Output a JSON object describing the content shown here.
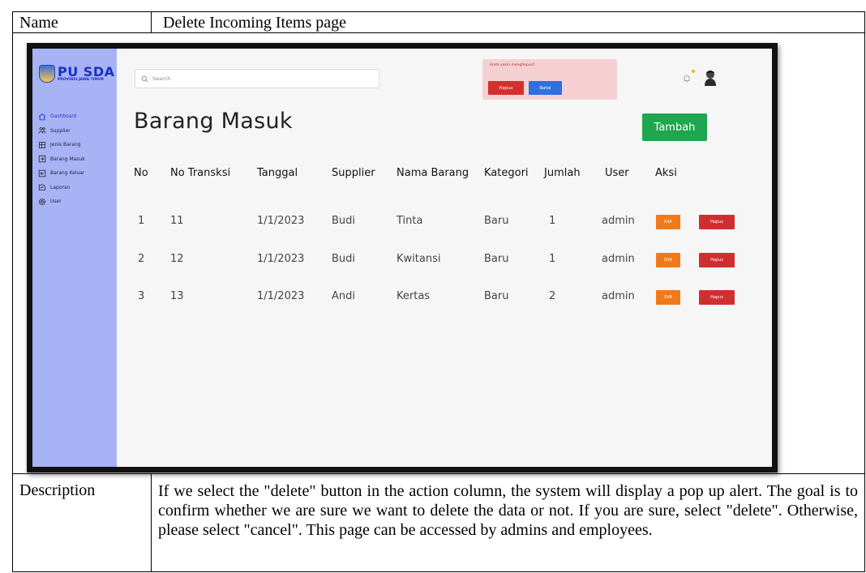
{
  "document": {
    "name_label": "Name",
    "name_value": "Delete Incoming Items page",
    "description_label": "Description",
    "description_text": "If we select the \"delete\" button in the action column, the system will display a pop up alert. The goal is to confirm whether we are sure we want to delete the data or not. If you are sure, select \"delete\". Otherwise, please select \"cancel\". This page can be accessed by admins and employees."
  },
  "app": {
    "logo": {
      "main": "PU SDA",
      "sub": "PROVINSI JAWA TIMUR"
    },
    "search_placeholder": "Search",
    "page_title": "Barang Masuk",
    "add_button": "Tambah",
    "sidebar": [
      {
        "label": "Dashboard",
        "icon": "home-icon",
        "active": true
      },
      {
        "label": "Supplier",
        "icon": "users-icon",
        "active": false
      },
      {
        "label": "Jenis Barang",
        "icon": "box-icon",
        "active": false
      },
      {
        "label": "Barang Masuk",
        "icon": "inbox-icon",
        "active": false
      },
      {
        "label": "Barang Keluar",
        "icon": "outbox-icon",
        "active": false
      },
      {
        "label": "Laporan",
        "icon": "report-icon",
        "active": false
      },
      {
        "label": "User",
        "icon": "gear-icon",
        "active": false
      }
    ],
    "popup": {
      "message": "Anda yakin menghapus?",
      "confirm": "Hapus",
      "cancel": "Batal"
    },
    "table": {
      "headers": [
        "No",
        "No Transksi",
        "Tanggal",
        "Supplier",
        "Nama Barang",
        "Kategori",
        "Jumlah",
        "User",
        "Aksi"
      ],
      "rows": [
        [
          "1",
          "11",
          "1/1/2023",
          "Budi",
          "Tinta",
          "Baru",
          "1",
          "admin"
        ],
        [
          "2",
          "12",
          "1/1/2023",
          "Budi",
          "Kwitansi",
          "Baru",
          "1",
          "admin"
        ],
        [
          "3",
          "13",
          "1/1/2023",
          "Andi",
          "Kertas",
          "Baru",
          "2",
          "admin"
        ]
      ],
      "edit_label": "Edit",
      "delete_label": "Hapus"
    },
    "colors": {
      "sidebar": "#a7b3f5",
      "add_button": "#1fa64f",
      "edit_button": "#f07a1a",
      "delete_button": "#d12f2f",
      "popup_bg": "#f5d0d2",
      "cancel_button": "#2f6fe0"
    }
  }
}
